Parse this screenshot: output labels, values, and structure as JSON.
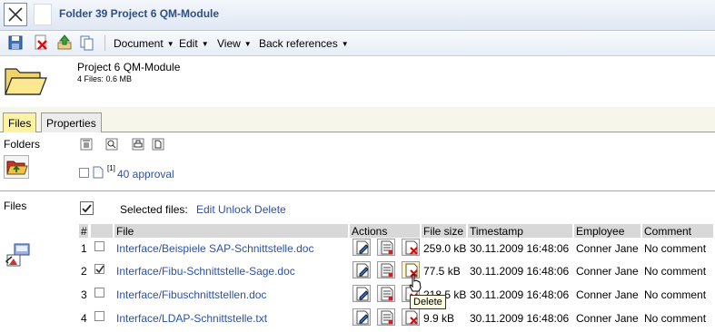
{
  "window": {
    "title": "Folder 39 Project 6 QM-Module"
  },
  "toolbar": {
    "icons": [
      "save-icon",
      "delete-icon",
      "upload-icon",
      "copy-icon"
    ],
    "menus": [
      "Document",
      "Edit",
      "View",
      "Back references"
    ]
  },
  "project": {
    "name": "Project 6 QM-Module",
    "summary": "4 Files: 0.6 MB"
  },
  "tabs": [
    "Files",
    "Properties"
  ],
  "folders": {
    "label": "Folders",
    "items": [
      {
        "superscript": "[1]",
        "name": "40 approval"
      }
    ]
  },
  "files": {
    "label": "Files",
    "selected_label": "Selected files:",
    "selected_actions": "Edit Unlock Delete",
    "columns": [
      "#",
      "",
      "File",
      "Actions",
      "File size",
      "Timestamp",
      "Employee",
      "Comment"
    ],
    "rows": [
      {
        "num": "1",
        "checked": false,
        "file": "Interface/Beispiele SAP-Schnittstelle.doc",
        "size": "259.0 kB",
        "timestamp": "30.11.2009 16:48:06",
        "employee": "Conner Jane",
        "comment": "No comment"
      },
      {
        "num": "2",
        "checked": true,
        "file": "Interface/Fibu-Schnittstelle-Sage.doc",
        "size": "77.5 kB",
        "timestamp": "30.11.2009 16:48:06",
        "employee": "Conner Jane",
        "comment": "No comment"
      },
      {
        "num": "3",
        "checked": false,
        "file": "Interface/Fibuschnittstellen.doc",
        "size": "218.5 kB",
        "timestamp": "30.11.2009 16:48:06",
        "employee": "Conner Jane",
        "comment": "No comment"
      },
      {
        "num": "4",
        "checked": false,
        "file": "Interface/LDAP-Schnittstelle.txt",
        "size": "9.9 kB",
        "timestamp": "30.11.2009 16:48:06",
        "employee": "Conner Jane",
        "comment": "No comment"
      }
    ]
  },
  "tooltip": "Delete",
  "colors": {
    "title": "#2c4f86",
    "link": "#2b51a6",
    "active_tab": "#fbf2a2",
    "header_cell": "#d8d8d8"
  }
}
